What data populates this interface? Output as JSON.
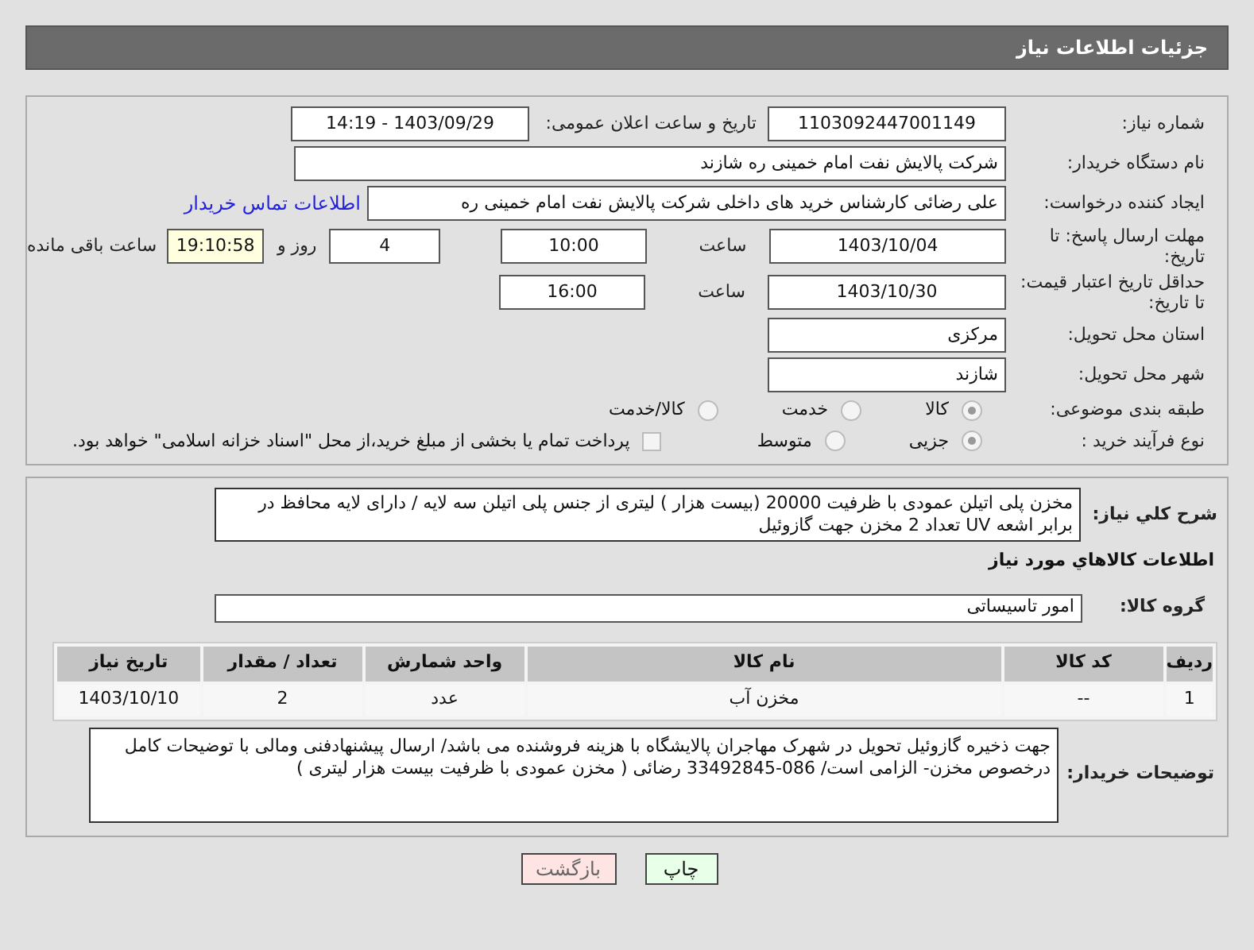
{
  "header": {
    "title": "جزئیات اطلاعات نیاز"
  },
  "need_number": {
    "label": "شماره نیاز:",
    "value": "1103092447001149"
  },
  "announce": {
    "label": "تاریخ و ساعت اعلان عمومی:",
    "value": "1403/09/29 - 14:19"
  },
  "buyer_org": {
    "label": "نام دستگاه خریدار:",
    "value": "شرکت پالایش نفت امام خمینی  ره  شازند"
  },
  "requester": {
    "label": "ایجاد کننده درخواست:",
    "value": "علی  رضائی کارشناس خرید های داخلی  شرکت پالایش نفت امام خمینی  ره",
    "link": "اطلاعات تماس خریدار"
  },
  "deadline": {
    "label": "مهلت ارسال پاسخ: تا تاریخ:",
    "date": "1403/10/04",
    "time_label": "ساعت",
    "time": "10:00",
    "days": "4",
    "days_label": "روز و",
    "remaining": "19:10:58",
    "remaining_label": "ساعت باقی مانده"
  },
  "validity": {
    "label": "حداقل تاریخ اعتبار قیمت: تا تاریخ:",
    "date": "1403/10/30",
    "time_label": "ساعت",
    "time": "16:00"
  },
  "province": {
    "label": "استان محل تحویل:",
    "value": "مرکزی"
  },
  "city": {
    "label": "شهر محل تحویل:",
    "value": "شازند"
  },
  "category": {
    "label": "طبقه بندی موضوعی:",
    "options": [
      {
        "label": "کالا",
        "selected": true
      },
      {
        "label": "خدمت",
        "selected": false
      },
      {
        "label": "کالا/خدمت",
        "selected": false
      }
    ]
  },
  "process": {
    "label": "نوع فرآیند خرید :",
    "options": [
      {
        "label": "جزیی",
        "selected": true
      },
      {
        "label": "متوسط",
        "selected": false
      }
    ],
    "treasury": {
      "label": "پرداخت تمام یا بخشی از مبلغ خرید،از محل \"اسناد خزانه اسلامی\" خواهد بود.",
      "checked": false
    }
  },
  "description": {
    "label": "شرح کلي نياز:",
    "value": "  مخزن  پلی اتیلن  عمودی با ظرفیت 20000 (بیست هزار ) لیتری  از جنس پلی اتیلن سه لایه / دارای لایه محافظ در برابر اشعه UV   تعداد 2 مخزن  جهت گازوئیل"
  },
  "goods_heading": "اطلاعات کالاهاي مورد نياز",
  "goods_group": {
    "label": "گروه کالا:",
    "value": "امور تاسیساتی"
  },
  "table": {
    "columns": [
      "ردیف",
      "کد کالا",
      "نام کالا",
      "واحد شمارش",
      "تعداد / مقدار",
      "تاریخ نیاز"
    ],
    "rows": [
      [
        "1",
        "--",
        "مخزن آب",
        "عدد",
        "2",
        "1403/10/10"
      ]
    ]
  },
  "buyer_notes": {
    "label": "توضیحات خریدار:",
    "value": "  جهت ذخیره گازوئیل   تحویل در شهرک مهاجران پالایشگاه با هزینه فروشنده  می باشد/ ارسال پیشنهادفنی ومالی با توضیحات کامل  درخصوص مخزن-    الزامی است/ 086-33492845 رضائی ( مخزن عمودی  با ظرفیت  بیست هزار لیتری )"
  },
  "buttons": {
    "print": "چاپ",
    "back": "بازگشت"
  }
}
